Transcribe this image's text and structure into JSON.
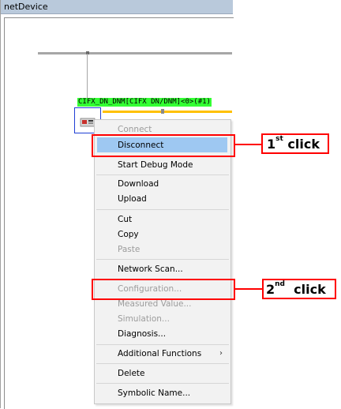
{
  "window": {
    "title": "netDevice"
  },
  "device": {
    "label": "CIFX_DN_DNM[CIFX DN/DNM]<0>(#1)",
    "icon": "device-card-icon"
  },
  "context_menu": {
    "items": [
      {
        "label": "Connect",
        "enabled": false
      },
      {
        "label": "Disconnect",
        "enabled": true,
        "highlighted": true
      },
      {
        "label": "Start Debug Mode",
        "enabled": true
      },
      {
        "label": "Download",
        "enabled": true
      },
      {
        "label": "Upload",
        "enabled": true
      },
      {
        "label": "Cut",
        "enabled": true
      },
      {
        "label": "Copy",
        "enabled": true
      },
      {
        "label": "Paste",
        "enabled": false
      },
      {
        "label": "Network Scan...",
        "enabled": true
      },
      {
        "label": "Configuration...",
        "enabled": false
      },
      {
        "label": "Measured Value...",
        "enabled": false
      },
      {
        "label": "Simulation...",
        "enabled": false
      },
      {
        "label": "Diagnosis...",
        "enabled": true
      },
      {
        "label": "Additional Functions",
        "enabled": true,
        "submenu_arrow": "›"
      },
      {
        "label": "Delete",
        "enabled": true
      },
      {
        "label": "Symbolic Name...",
        "enabled": true
      }
    ]
  },
  "callouts": {
    "first": {
      "ordinal": "1",
      "suffix": "st",
      "text": "click"
    },
    "second": {
      "ordinal": "2",
      "suffix": "nd",
      "text": "click"
    }
  },
  "colors": {
    "highlight": "#9ec8f2",
    "annotation": "#ff0000",
    "device_label_bg": "#33ff33",
    "bus_yellow": "#ffc000"
  }
}
